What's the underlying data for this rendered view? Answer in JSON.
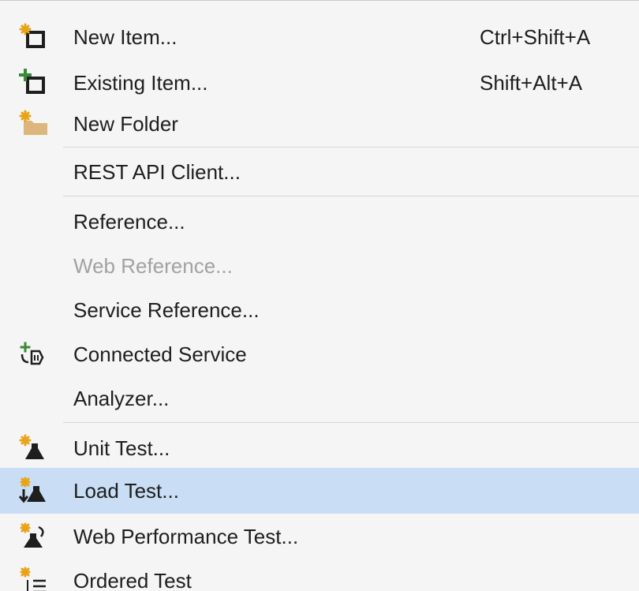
{
  "menu": {
    "items": [
      {
        "label": "New Item...",
        "shortcut": "Ctrl+Shift+A",
        "icon": "new-item-icon"
      },
      {
        "label": "Existing Item...",
        "shortcut": "Shift+Alt+A",
        "icon": "existing-item-icon"
      },
      {
        "label": "New Folder",
        "shortcut": "",
        "icon": "new-folder-icon"
      },
      {
        "label": "REST API Client...",
        "shortcut": "",
        "icon": ""
      },
      {
        "label": "Reference...",
        "shortcut": "",
        "icon": ""
      },
      {
        "label": "Web Reference...",
        "shortcut": "",
        "icon": "",
        "disabled": true
      },
      {
        "label": "Service Reference...",
        "shortcut": "",
        "icon": ""
      },
      {
        "label": "Connected Service",
        "shortcut": "",
        "icon": "connected-service-icon"
      },
      {
        "label": "Analyzer...",
        "shortcut": "",
        "icon": ""
      },
      {
        "label": "Unit Test...",
        "shortcut": "",
        "icon": "unit-test-icon"
      },
      {
        "label": "Load Test...",
        "shortcut": "",
        "icon": "load-test-icon",
        "highlighted": true
      },
      {
        "label": "Web Performance Test...",
        "shortcut": "",
        "icon": "web-performance-test-icon"
      },
      {
        "label": "Ordered Test",
        "shortcut": "",
        "icon": "ordered-test-icon"
      }
    ]
  },
  "colors": {
    "background": "#f5f5f5",
    "highlight": "#c9def5",
    "disabled_text": "#a2a2a2",
    "accent_star": "#e8a317",
    "accent_plus": "#388a34",
    "folder": "#dcb67a"
  }
}
